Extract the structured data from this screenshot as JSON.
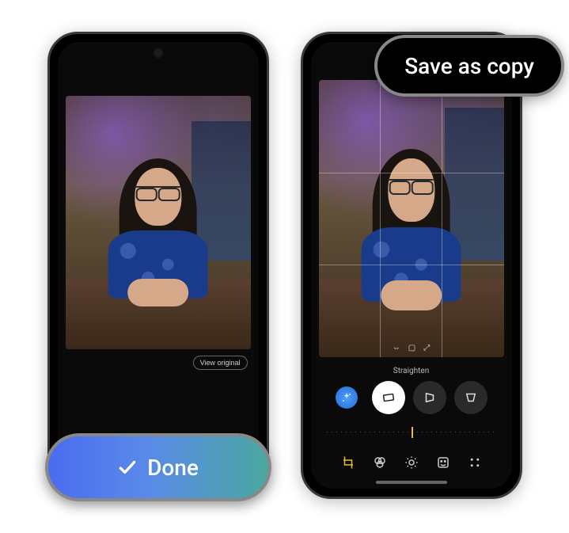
{
  "left": {
    "view_original_label": "View original",
    "done_label": "Done"
  },
  "right": {
    "save_as_copy_label": "Save as copy",
    "straighten_label": "Straighten",
    "tools": {
      "sparkle": "auto-enhance",
      "straighten": "straighten",
      "skew_h": "horizontal-perspective",
      "skew_v": "vertical-perspective"
    },
    "bottom_nav": {
      "crop": "Crop",
      "filters": "Filters",
      "adjust": "Adjust",
      "markup": "Markup",
      "more": "More"
    }
  }
}
